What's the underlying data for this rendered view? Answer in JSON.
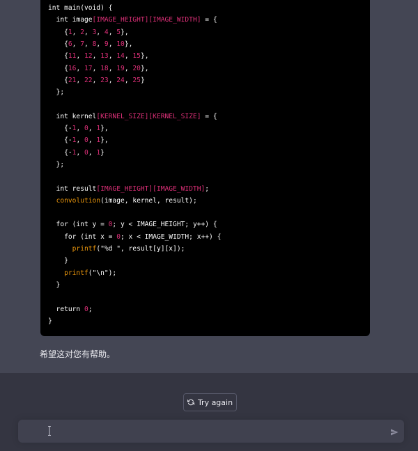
{
  "code": {
    "language": "c",
    "lines": [
      [
        {
          "t": "int main(void) {",
          "c": "kw"
        }
      ],
      [
        {
          "t": "  int image",
          "c": "kw"
        },
        {
          "t": "[IMAGE_HEIGHT][IMAGE_WIDTH]",
          "c": "mac"
        },
        {
          "t": " = {",
          "c": "kw"
        }
      ],
      [
        {
          "t": "    {",
          "c": "kw"
        },
        {
          "t": "1",
          "c": "num"
        },
        {
          "t": ", ",
          "c": "kw"
        },
        {
          "t": "2",
          "c": "num"
        },
        {
          "t": ", ",
          "c": "kw"
        },
        {
          "t": "3",
          "c": "num"
        },
        {
          "t": ", ",
          "c": "kw"
        },
        {
          "t": "4",
          "c": "num"
        },
        {
          "t": ", ",
          "c": "kw"
        },
        {
          "t": "5",
          "c": "num"
        },
        {
          "t": "},",
          "c": "kw"
        }
      ],
      [
        {
          "t": "    {",
          "c": "kw"
        },
        {
          "t": "6",
          "c": "num"
        },
        {
          "t": ", ",
          "c": "kw"
        },
        {
          "t": "7",
          "c": "num"
        },
        {
          "t": ", ",
          "c": "kw"
        },
        {
          "t": "8",
          "c": "num"
        },
        {
          "t": ", ",
          "c": "kw"
        },
        {
          "t": "9",
          "c": "num"
        },
        {
          "t": ", ",
          "c": "kw"
        },
        {
          "t": "10",
          "c": "num"
        },
        {
          "t": "},",
          "c": "kw"
        }
      ],
      [
        {
          "t": "    {",
          "c": "kw"
        },
        {
          "t": "11",
          "c": "num"
        },
        {
          "t": ", ",
          "c": "kw"
        },
        {
          "t": "12",
          "c": "num"
        },
        {
          "t": ", ",
          "c": "kw"
        },
        {
          "t": "13",
          "c": "num"
        },
        {
          "t": ", ",
          "c": "kw"
        },
        {
          "t": "14",
          "c": "num"
        },
        {
          "t": ", ",
          "c": "kw"
        },
        {
          "t": "15",
          "c": "num"
        },
        {
          "t": "},",
          "c": "kw"
        }
      ],
      [
        {
          "t": "    {",
          "c": "kw"
        },
        {
          "t": "16",
          "c": "num"
        },
        {
          "t": ", ",
          "c": "kw"
        },
        {
          "t": "17",
          "c": "num"
        },
        {
          "t": ", ",
          "c": "kw"
        },
        {
          "t": "18",
          "c": "num"
        },
        {
          "t": ", ",
          "c": "kw"
        },
        {
          "t": "19",
          "c": "num"
        },
        {
          "t": ", ",
          "c": "kw"
        },
        {
          "t": "20",
          "c": "num"
        },
        {
          "t": "},",
          "c": "kw"
        }
      ],
      [
        {
          "t": "    {",
          "c": "kw"
        },
        {
          "t": "21",
          "c": "num"
        },
        {
          "t": ", ",
          "c": "kw"
        },
        {
          "t": "22",
          "c": "num"
        },
        {
          "t": ", ",
          "c": "kw"
        },
        {
          "t": "23",
          "c": "num"
        },
        {
          "t": ", ",
          "c": "kw"
        },
        {
          "t": "24",
          "c": "num"
        },
        {
          "t": ", ",
          "c": "kw"
        },
        {
          "t": "25",
          "c": "num"
        },
        {
          "t": "}",
          "c": "kw"
        }
      ],
      [
        {
          "t": "  };",
          "c": "kw"
        }
      ],
      [],
      [
        {
          "t": "  int kernel",
          "c": "kw"
        },
        {
          "t": "[KERNEL_SIZE][KERNEL_SIZE]",
          "c": "mac"
        },
        {
          "t": " = {",
          "c": "kw"
        }
      ],
      [
        {
          "t": "    {-",
          "c": "kw"
        },
        {
          "t": "1",
          "c": "num"
        },
        {
          "t": ", ",
          "c": "kw"
        },
        {
          "t": "0",
          "c": "num"
        },
        {
          "t": ", ",
          "c": "kw"
        },
        {
          "t": "1",
          "c": "num"
        },
        {
          "t": "},",
          "c": "kw"
        }
      ],
      [
        {
          "t": "    {-",
          "c": "kw"
        },
        {
          "t": "1",
          "c": "num"
        },
        {
          "t": ", ",
          "c": "kw"
        },
        {
          "t": "0",
          "c": "num"
        },
        {
          "t": ", ",
          "c": "kw"
        },
        {
          "t": "1",
          "c": "num"
        },
        {
          "t": "},",
          "c": "kw"
        }
      ],
      [
        {
          "t": "    {-",
          "c": "kw"
        },
        {
          "t": "1",
          "c": "num"
        },
        {
          "t": ", ",
          "c": "kw"
        },
        {
          "t": "0",
          "c": "num"
        },
        {
          "t": ", ",
          "c": "kw"
        },
        {
          "t": "1",
          "c": "num"
        },
        {
          "t": "}",
          "c": "kw"
        }
      ],
      [
        {
          "t": "  };",
          "c": "kw"
        }
      ],
      [],
      [
        {
          "t": "  int result",
          "c": "kw"
        },
        {
          "t": "[IMAGE_HEIGHT][IMAGE_WIDTH]",
          "c": "mac"
        },
        {
          "t": ";",
          "c": "kw"
        }
      ],
      [
        {
          "t": "  ",
          "c": "kw"
        },
        {
          "t": "convolution",
          "c": "fnc"
        },
        {
          "t": "(image, kernel, result);",
          "c": "kw"
        }
      ],
      [],
      [
        {
          "t": "  for (int y = ",
          "c": "kw"
        },
        {
          "t": "0",
          "c": "num"
        },
        {
          "t": "; y < IMAGE_HEIGHT; y++) {",
          "c": "kw"
        }
      ],
      [
        {
          "t": "    for (int x = ",
          "c": "kw"
        },
        {
          "t": "0",
          "c": "num"
        },
        {
          "t": "; x < IMAGE_WIDTH; x++) {",
          "c": "kw"
        }
      ],
      [
        {
          "t": "      ",
          "c": "kw"
        },
        {
          "t": "printf",
          "c": "fnc"
        },
        {
          "t": "(\"%d \", result[y][x]);",
          "c": "kw"
        }
      ],
      [
        {
          "t": "    }",
          "c": "kw"
        }
      ],
      [
        {
          "t": "    ",
          "c": "kw"
        },
        {
          "t": "printf",
          "c": "fnc"
        },
        {
          "t": "(\"\\n\");",
          "c": "kw"
        }
      ],
      [
        {
          "t": "  }",
          "c": "kw"
        }
      ],
      [],
      [
        {
          "t": "  return ",
          "c": "kw"
        },
        {
          "t": "0",
          "c": "num"
        },
        {
          "t": ";",
          "c": "kw"
        }
      ],
      [
        {
          "t": "}",
          "c": "kw"
        }
      ]
    ]
  },
  "message": {
    "closing_text": "希望这对您有帮助。"
  },
  "actions": {
    "try_again_label": "Try again",
    "try_again_icon": "refresh-icon"
  },
  "composer": {
    "value": "",
    "placeholder": "",
    "send_icon": "send-icon"
  },
  "colors": {
    "chat_bg": "#444654",
    "code_bg": "#000000",
    "bottom_bg": "#343541",
    "composer_bg": "#40414f",
    "token_macro": "#df3079",
    "token_function": "#e9950c"
  }
}
